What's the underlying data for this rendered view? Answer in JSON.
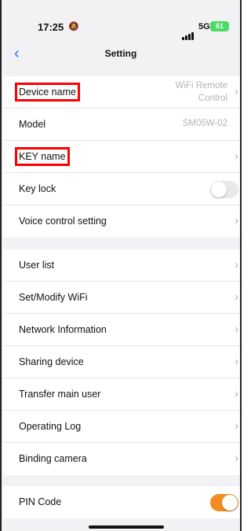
{
  "status_bar": {
    "time": "17:25",
    "mute_icon": "bell-slash-icon",
    "network": "5G",
    "battery": "61"
  },
  "nav": {
    "back_icon": "chevron-left-icon",
    "title": "Setting"
  },
  "group1": {
    "device_name": {
      "label": "Device name",
      "value_line1": "WiFi Remote",
      "value_line2": "Control"
    },
    "model": {
      "label": "Model",
      "value": "SM05W-02"
    },
    "key_name": {
      "label": "KEY name"
    },
    "key_lock": {
      "label": "Key lock",
      "enabled": false
    },
    "voice_control": {
      "label": "Voice control setting"
    }
  },
  "group2": {
    "items": [
      {
        "label": "User list"
      },
      {
        "label": "Set/Modify WiFi"
      },
      {
        "label": "Network Information"
      },
      {
        "label": "Sharing device"
      },
      {
        "label": "Transfer main user"
      },
      {
        "label": "Operating Log"
      },
      {
        "label": "Binding camera"
      }
    ]
  },
  "group3": {
    "pin_code": {
      "label": "PIN Code",
      "enabled": true
    }
  },
  "colors": {
    "accent_blue": "#1a7bff",
    "toggle_on": "#f28c1f",
    "highlight_box": "#ff0000"
  }
}
